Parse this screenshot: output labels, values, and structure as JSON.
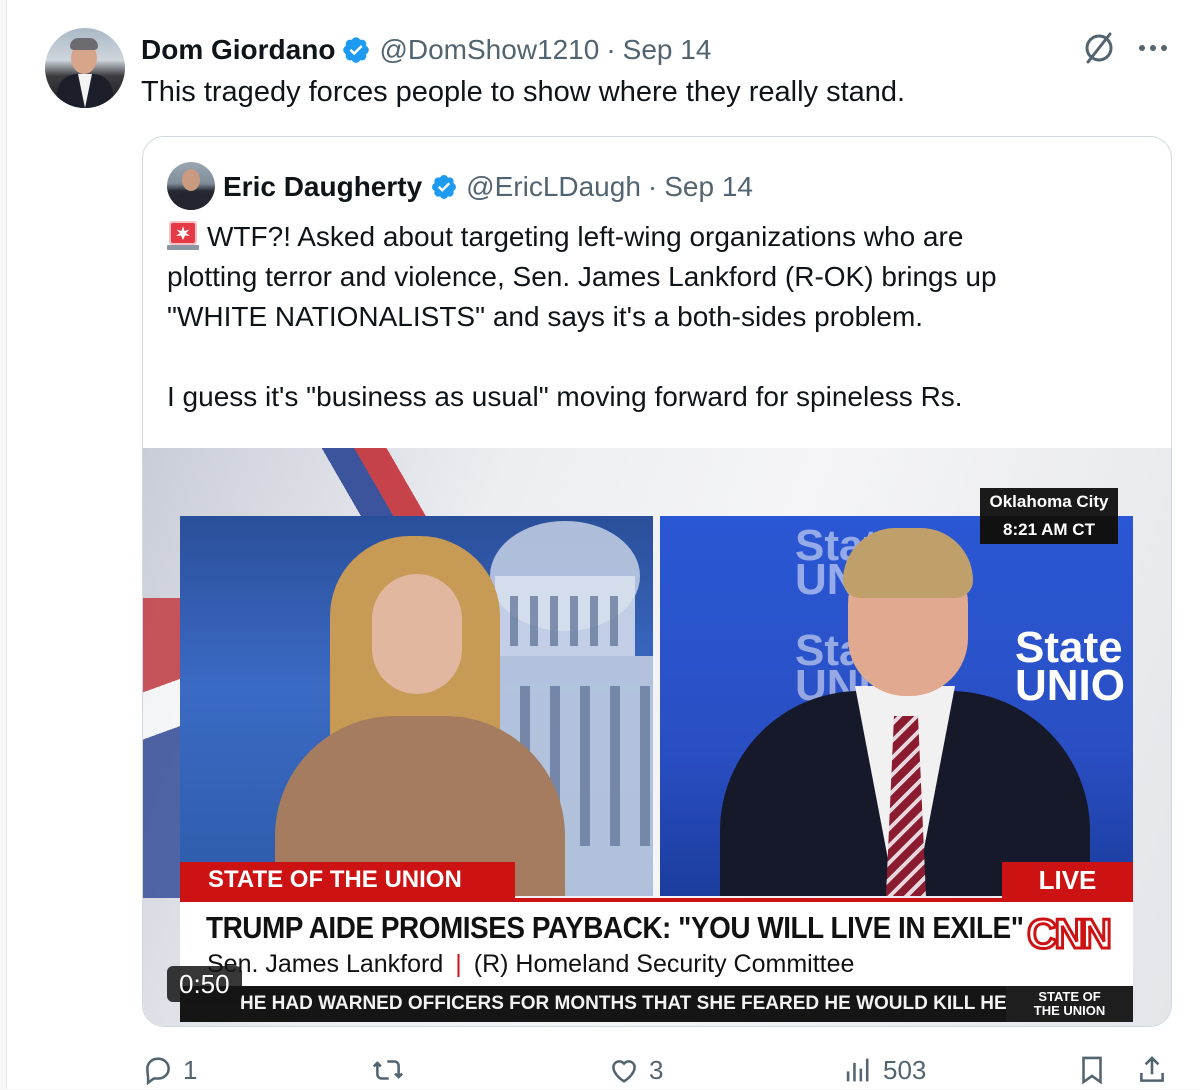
{
  "tweet": {
    "author_name": "Dom Giordano",
    "handle": "@DomShow1210",
    "separator": "·",
    "date": "Sep 14",
    "text": "This tragedy forces people to show where they really stand."
  },
  "quote": {
    "author_name": "Eric Daugherty",
    "handle": "@EricLDaugh",
    "separator": "·",
    "date": "Sep 14",
    "lines": [
      "WTF?! Asked about targeting left-wing organizations who are",
      "plotting terror and violence, Sen. James Lankford (R-OK) brings up",
      "\"WHITE NATIONALISTS\" and says it's a both-sides problem."
    ],
    "line_followup": "I guess it's \"business as usual\" moving forward for spineless Rs.",
    "video": {
      "duration": "0:50",
      "location": "Oklahoma City",
      "local_time": "8:21 AM CT",
      "show_tag": "STATE OF THE UNION",
      "live_tag": "LIVE",
      "headline": "TRUMP AIDE PROMISES PAYBACK: \"YOU WILL LIVE IN EXILE\"",
      "guest_name": "Sen. James Lankford",
      "guest_separator": "|",
      "guest_title": "(R) Homeland Security Committee",
      "network": "CNN",
      "ticker": "HE HAD WARNED OFFICERS FOR MONTHS THAT SHE FEARED HE WOULD KILL HER. TWO",
      "ticker_logo_line1": "STATE OF",
      "ticker_logo_line2": "THE UNION",
      "backdrop_words": [
        "State",
        "UNIO",
        "State",
        "UNIO",
        "State",
        "UNIO"
      ]
    }
  },
  "actions": {
    "replies": "1",
    "reposts": "",
    "likes": "3",
    "views": "503"
  },
  "colors": {
    "verified": "#1d9bf0",
    "muted": "#536471",
    "cnn_red": "#cc1212"
  },
  "icons": [
    "verified-badge-icon",
    "grok-icon",
    "more-icon",
    "siren-emoji-icon",
    "reply-icon",
    "repost-icon",
    "like-icon",
    "views-icon",
    "bookmark-icon",
    "share-icon"
  ]
}
